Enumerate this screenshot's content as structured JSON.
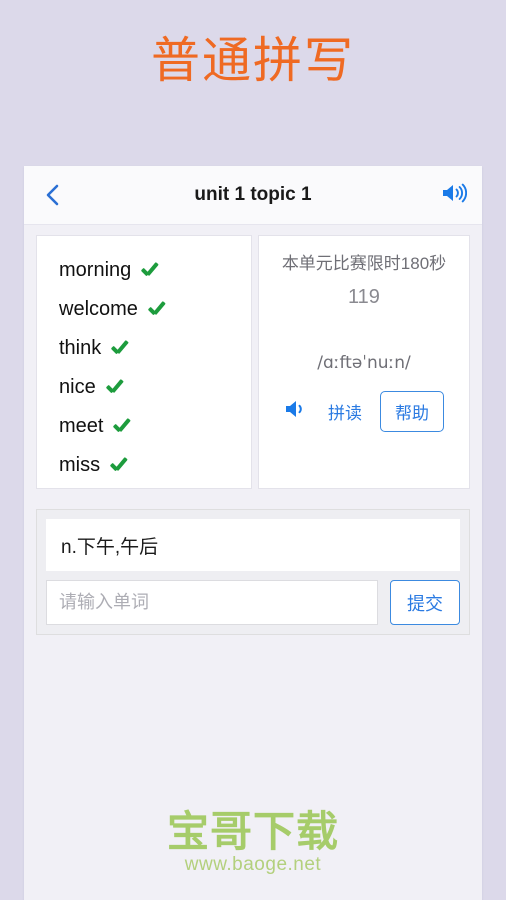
{
  "page": {
    "title": "普通拼写",
    "title_color": "#ef6a23",
    "background_color": "#dcd9ea"
  },
  "header": {
    "back_icon": "chevron-left-icon",
    "title": "unit 1 topic 1",
    "speaker_icon": "speaker-icon",
    "accent_color": "#2a7ae2"
  },
  "word_list": {
    "items": [
      {
        "word": "morning",
        "status_icon": "check-icon"
      },
      {
        "word": "welcome",
        "status_icon": "check-icon"
      },
      {
        "word": "think",
        "status_icon": "check-icon"
      },
      {
        "word": "nice",
        "status_icon": "check-icon"
      },
      {
        "word": "meet",
        "status_icon": "check-icon"
      },
      {
        "word": "miss",
        "status_icon": "check-icon"
      }
    ],
    "check_color": "#1d9c3d"
  },
  "info_panel": {
    "limit_text": "本单元比赛限时180秒",
    "countdown": "119",
    "phonetic": "/ɑːftəˈnuːn/",
    "speaker_icon": "speaker-icon",
    "spell_link": "拼读",
    "help_button": "帮助"
  },
  "answer": {
    "definition": "n.下午,午后",
    "input_value": "",
    "input_placeholder": "请输入单词",
    "submit_label": "提交"
  },
  "watermark": {
    "main": "宝哥下载",
    "sub": "www.baoge.net",
    "color": "#a6cc6a"
  }
}
